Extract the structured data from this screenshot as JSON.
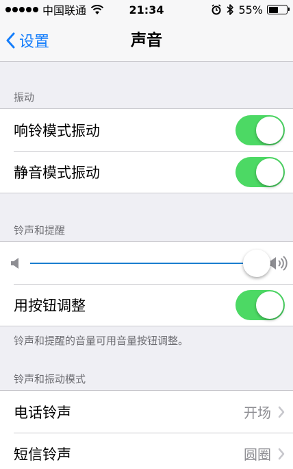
{
  "status_bar": {
    "carrier": "中国联通",
    "time": "21:34",
    "battery": "55%",
    "battery_level": 0.55,
    "icons": [
      "signal-dots-icon",
      "wifi-icon",
      "alarm-icon",
      "bluetooth-icon",
      "battery-icon"
    ]
  },
  "nav": {
    "back_label": "设置",
    "title": "声音"
  },
  "sections": {
    "vibrate_header": "振动",
    "ringer_header": "铃声和提醒",
    "ringer_footer": "铃声和提醒的音量可用音量按钮调整。",
    "patterns_header": "铃声和振动模式"
  },
  "vibrate": [
    {
      "label": "响铃模式振动",
      "on": true
    },
    {
      "label": "静音模式振动",
      "on": true
    }
  ],
  "ringer": {
    "volume": 0.99,
    "min_icon": "speaker-low-icon",
    "max_icon": "speaker-high-icon",
    "change_with_buttons": {
      "label": "用按钮调整",
      "on": true
    }
  },
  "patterns": [
    {
      "label": "电话铃声",
      "value": "开场"
    },
    {
      "label": "短信铃声",
      "value": "圆圈"
    }
  ],
  "colors": {
    "accent": "#157efb",
    "toggle_on": "#4cd964",
    "background": "#efeff4",
    "secondary_text": "#8e8e93"
  }
}
